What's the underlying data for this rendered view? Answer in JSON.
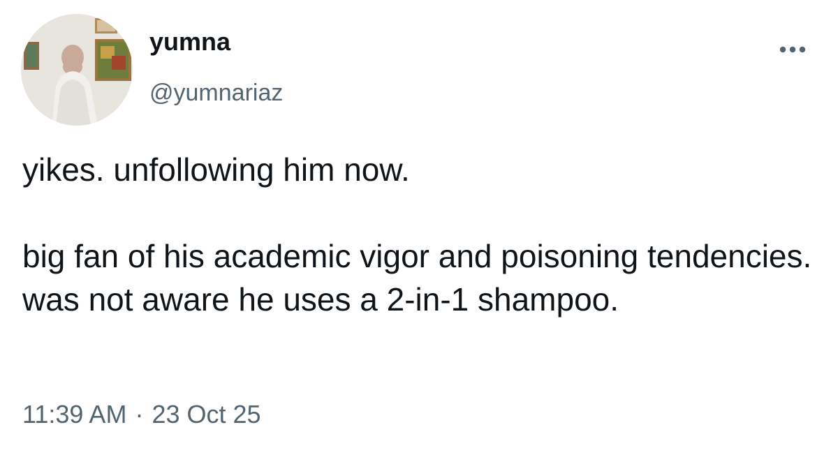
{
  "author": {
    "display_name": "yumna",
    "handle": "@yumnariaz",
    "avatar_icon": "profile-photo"
  },
  "more_icon": "ellipsis-icon",
  "tweet": {
    "paragraph_1": "yikes. unfollowing him now.",
    "paragraph_2": "big fan of his academic vigor and poisoning tendencies. was not aware he uses a 2-in-1 shampoo.",
    "time": "11:39 AM",
    "separator": "·",
    "date": "23 Oct 25"
  },
  "colors": {
    "text": "#0f1419",
    "secondary": "#536471",
    "background": "#ffffff"
  }
}
